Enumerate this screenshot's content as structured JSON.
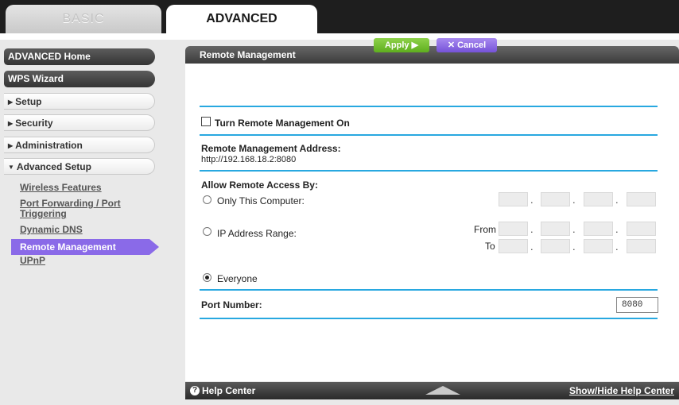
{
  "tabs": [
    {
      "label": "BASIC"
    },
    {
      "label": "ADVANCED"
    }
  ],
  "sidebar": {
    "items": [
      {
        "label": "ADVANCED Home"
      },
      {
        "label": "WPS Wizard"
      },
      {
        "label": "Setup",
        "arrow": "▶"
      },
      {
        "label": "Security",
        "arrow": "▶"
      },
      {
        "label": "Administration",
        "arrow": "▶"
      },
      {
        "label": "Advanced Setup",
        "arrow": "▼"
      }
    ],
    "submenu": [
      {
        "label": "Wireless Features"
      },
      {
        "label": "Port Forwarding / Port"
      },
      {
        "label": "Triggering"
      },
      {
        "label": "Dynamic DNS"
      },
      {
        "label": "Remote Management"
      },
      {
        "label": "UPnP"
      }
    ]
  },
  "main": {
    "title": "Remote Management",
    "apply_label": "Apply ▶",
    "cancel_label": "✕ Cancel",
    "turn_on_label": "Turn Remote Management On",
    "address_heading": "Remote Management Address:",
    "address_value": "http://192.168.18.2:8080",
    "access_heading": "Allow Remote Access By:",
    "only_this_label": "Only This Computer:",
    "ip_range_label": "IP Address Range:",
    "from_label": "From",
    "to_label": "To",
    "everyone_label": "Everyone",
    "port_label": "Port Number:",
    "port_value": "8080",
    "selected_access": "Everyone"
  },
  "footer": {
    "help_icon": "?",
    "help_label": "Help Center",
    "showhide_label": "Show/Hide Help Center"
  },
  "colors": {
    "accent_purple": "#8a6ae8",
    "divider_blue": "#28a8e0",
    "apply_green": "#6cbd2a"
  }
}
